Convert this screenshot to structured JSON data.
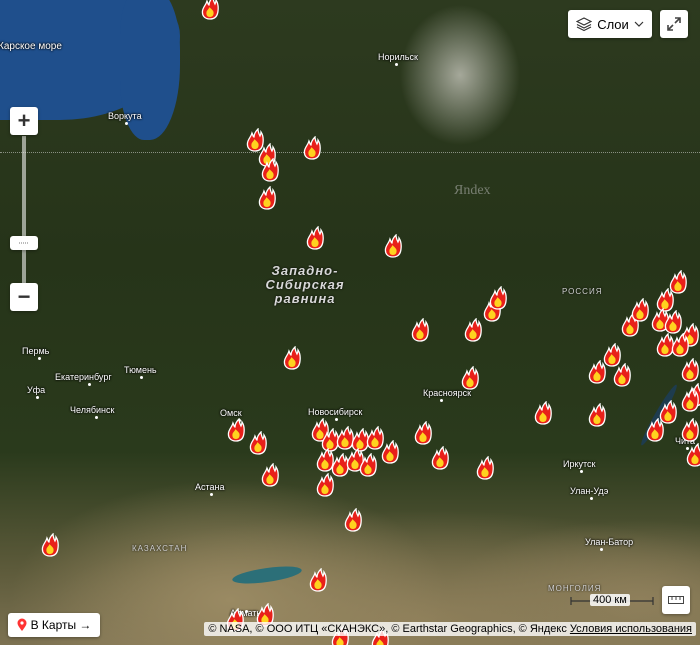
{
  "controls": {
    "layers_label": "Слои",
    "zoom_in": "+",
    "zoom_out": "−",
    "open_in_maps_label": "В Карты →",
    "scale_label": "400 км"
  },
  "map": {
    "cities": [
      "Норильск",
      "Воркута",
      "Пермь",
      "Екатеринбург",
      "Тюмень",
      "Уфа",
      "Челябинск",
      "Омск",
      "Новосибирск",
      "Красноярск",
      "Астана",
      "Иркутск",
      "Улан-Удэ",
      "Чита",
      "Улан-Батор",
      "Алматы"
    ],
    "sea": "Карское море",
    "region_label": "Западно-Сибирская равнина",
    "countries": [
      "РОССИЯ",
      "КАЗАХСТАН",
      "МОНГОЛИЯ"
    ],
    "watermark": "Яndex",
    "marker_type": "fire-icon",
    "colors": {
      "flame_outer": "#e8201a",
      "flame_inner": "#ffd21f",
      "sea": "#1f4f8c"
    }
  },
  "attribution": {
    "text": "© NASA, © ООО ИТЦ «СКАНЭКС», © Earthstar Geographics, © Яндекс",
    "terms_link": "Условия использования"
  }
}
